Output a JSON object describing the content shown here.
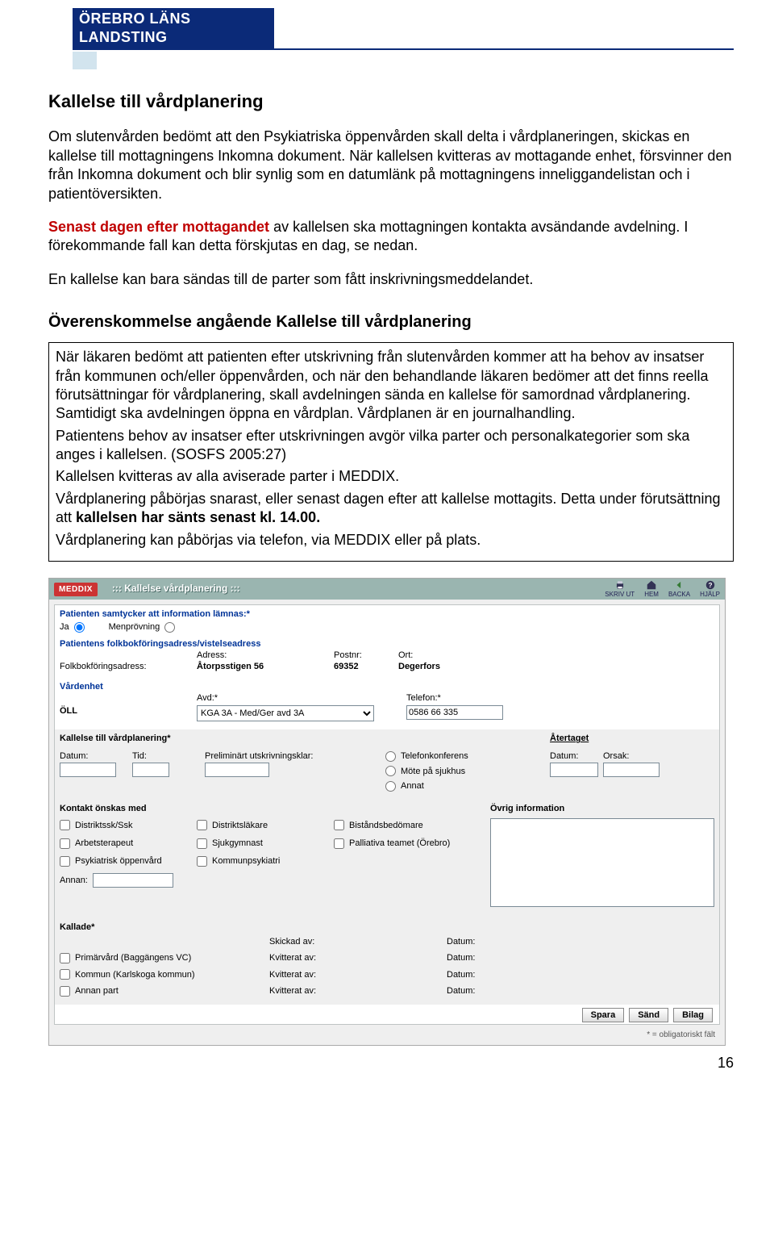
{
  "header": {
    "org": "ÖREBRO LÄNS LANDSTING"
  },
  "doc": {
    "title": "Kallelse till vårdplanering",
    "p1": "Om slutenvården bedömt att den Psykiatriska öppenvården skall delta i vårdplaneringen, skickas en kallelse till mottagningens Inkomna dokument. När kallelsen kvitteras av mottagande enhet, försvinner den från Inkomna dokument och blir synlig som en datumlänk på mottagningens inneliggandelistan och i patientöversikten.",
    "p2a": "Senast dagen efter mottagandet",
    "p2b": " av kallelsen ska mottagningen kontakta avsändande avdelning. I förekommande fall kan detta förskjutas en dag, se nedan.",
    "p3": "En kallelse kan bara sändas till de parter som fått inskrivningsmeddelandet.",
    "h2": "Överenskommelse angående Kallelse till vårdplanering",
    "box": {
      "l1": "När läkaren bedömt att patienten efter utskrivning från slutenvården kommer att ha behov av insatser från kommunen och/eller öppenvården, och när den behandlande läkaren bedömer att det finns reella förutsättningar för vårdplanering, skall avdelningen sända en kallelse för samordnad vårdplanering. Samtidigt ska avdelningen öppna en vårdplan. Vårdplanen är en journalhandling.",
      "l2": "Patientens behov av insatser efter utskrivningen avgör vilka parter och personalkategorier som ska anges i kallelsen. (SOSFS 2005:27)",
      "l3": "Kallelsen kvitteras av alla aviserade parter i MEDDIX.",
      "l4a": "Vårdplanering påbörjas snarast, eller senast dagen efter att kallelse mottagits. Detta under förutsättning att ",
      "l4b": "kallelsen har sänts senast kl. 14.00.",
      "l5": "Vårdplanering kan påbörjas via telefon, via MEDDIX eller på plats."
    }
  },
  "form": {
    "logo": "MEDDIX",
    "topbar_title": "::: Kallelse vårdplanering :::",
    "toolbar": {
      "print": "SKRIV UT",
      "home": "HEM",
      "back": "BACKA",
      "help": "HJÄLP"
    },
    "consent": {
      "title": "Patienten samtycker att information lämnas:*",
      "opt_yes": "Ja",
      "opt_men": "Menprövning"
    },
    "addr": {
      "title": "Patientens folkbokföringsadress/vistelseadress",
      "col_adress": "Adress:",
      "col_postnr": "Postnr:",
      "col_ort": "Ort:",
      "row_label": "Folkbokföringsadress:",
      "adress_val": "Åtorpsstigen 56",
      "postnr_val": "69352",
      "ort_val": "Degerfors"
    },
    "vardenhet": {
      "title": "Vårdenhet",
      "col_avd": "Avd:*",
      "col_tel": "Telefon:*",
      "unit": "ÖLL",
      "avd_val": "KGA 3A - Med/Ger avd 3A",
      "tel_val": "0586 66 335"
    },
    "kallelse": {
      "title": "Kallelse till vårdplanering*",
      "col_datum": "Datum:",
      "col_tid": "Tid:",
      "col_prel": "Preliminärt utskrivningsklar:",
      "opt_tele": "Telefonkonferens",
      "opt_mote": "Möte på sjukhus",
      "opt_annat": "Annat",
      "atertaget_title": "Återtaget",
      "col_orsak": "Orsak:"
    },
    "kontakt": {
      "title": "Kontakt önskas med",
      "c1": "Distriktssk/Ssk",
      "c2": "Distriktsläkare",
      "c3": "Biståndsbedömare",
      "c4": "Arbetsterapeut",
      "c5": "Sjukgymnast",
      "c6": "Palliativa teamet (Örebro)",
      "c7": "Psykiatrisk öppenvård",
      "c8": "Kommunpsykiatri",
      "annan": "Annan:"
    },
    "ovrig": {
      "title": "Övrig information"
    },
    "kallade": {
      "title": "Kallade*",
      "row1": "Primärvård (Baggängens VC)",
      "row2": "Kommun (Karlskoga kommun)",
      "row3": "Annan part",
      "skickad": "Skickad av:",
      "kvitterat": "Kvitterat av:",
      "datum": "Datum:"
    },
    "buttons": {
      "spara": "Spara",
      "sand": "Sänd",
      "bilag": "Bilag"
    },
    "footnote": "* = obligatoriskt fält"
  },
  "page_number": "16"
}
